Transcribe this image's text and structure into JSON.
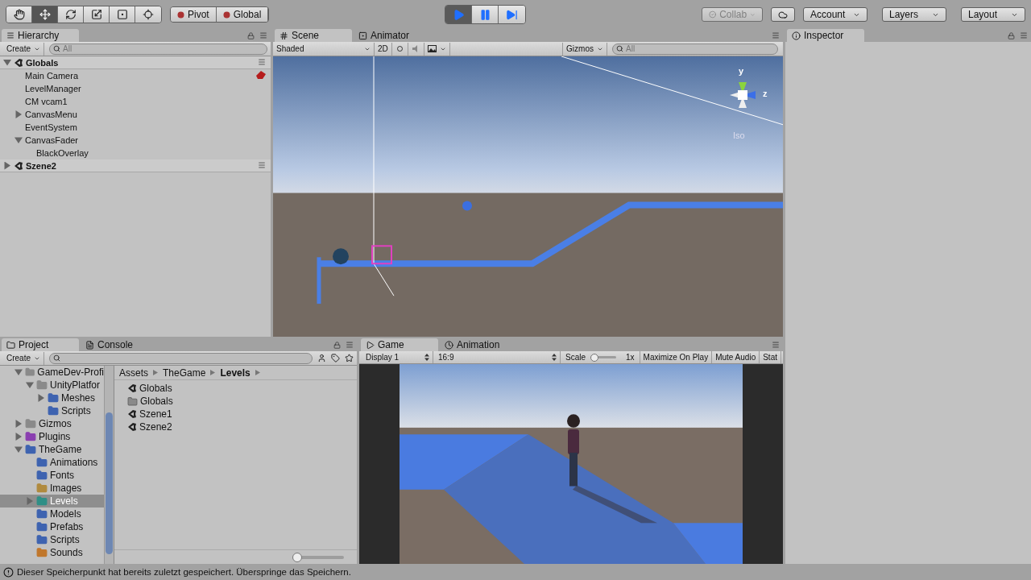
{
  "toolbar": {
    "transform_tools": [
      {
        "selected": false
      },
      {
        "selected": true
      },
      {
        "selected": false
      },
      {
        "selected": false
      },
      {
        "selected": false
      },
      {
        "selected": false
      }
    ],
    "pivot_buttons": [
      "Pivot",
      "Global"
    ],
    "play_controls": [
      {
        "kind": "play",
        "selected": true
      },
      {
        "kind": "pause",
        "selected": false
      },
      {
        "kind": "step",
        "selected": false
      }
    ],
    "collab": {
      "label": "Collab",
      "disabled": true
    },
    "menus": [
      "Account",
      "Layers",
      "Layout"
    ]
  },
  "hierarchy": {
    "tab": "Hierarchy",
    "create": "Create",
    "search_placeholder": "All",
    "scenes": [
      {
        "name": "Globals",
        "expanded": true,
        "children": [
          {
            "name": "Main Camera",
            "warning": true
          },
          {
            "name": "LevelManager"
          },
          {
            "name": "CM vcam1"
          },
          {
            "name": "CanvasMenu",
            "expanded": false
          },
          {
            "name": "EventSystem"
          },
          {
            "name": "CanvasFader",
            "expanded": true,
            "children": [
              {
                "name": "BlackOverlay"
              }
            ]
          }
        ]
      },
      {
        "name": "Szene2",
        "expanded": false
      }
    ]
  },
  "scene": {
    "tabs": [
      {
        "label": "Scene",
        "kind": "scene",
        "selected": true
      },
      {
        "label": "Animator",
        "kind": "animator",
        "selected": false
      }
    ],
    "shading": "Shaded",
    "mode_2d": "2D",
    "gizmos": "Gizmos",
    "search_placeholder": "All",
    "axis_labels": [
      "y",
      "z"
    ],
    "projection": "Iso"
  },
  "inspector": {
    "tab": "Inspector"
  },
  "project": {
    "tabs": [
      {
        "label": "Project",
        "kind": "project",
        "selected": true
      },
      {
        "label": "Console",
        "kind": "console",
        "selected": false
      }
    ],
    "create": "Create",
    "folders": [
      {
        "name": "GameDev-Profi",
        "color": "#8a8a8a",
        "selected": false,
        "expanded": true,
        "children": [
          {
            "name": "UnityPlatfor",
            "color": "#8a8a8a",
            "selected": false,
            "expanded": true,
            "children": [
              {
                "name": "Meshes",
                "color": "#3e63b0",
                "selected": false,
                "expanded": false
              },
              {
                "name": "Scripts",
                "color": "#3e63b0",
                "selected": false
              }
            ]
          }
        ]
      },
      {
        "name": "Gizmos",
        "color": "#8a8a8a",
        "selected": false,
        "expanded": false
      },
      {
        "name": "Plugins",
        "color": "#8a3fb0",
        "selected": false,
        "expanded": false
      },
      {
        "name": "TheGame",
        "color": "#3e63b0",
        "selected": false,
        "expanded": true,
        "children": [
          {
            "name": "Animations",
            "color": "#3e63b0",
            "selected": false
          },
          {
            "name": "Fonts",
            "color": "#3e63b0",
            "selected": false
          },
          {
            "name": "Images",
            "color": "#b08a3e",
            "selected": false
          },
          {
            "name": "Levels",
            "color": "#2f8f86",
            "selected": true,
            "expanded": false
          },
          {
            "name": "Models",
            "color": "#3e63b0",
            "selected": false
          },
          {
            "name": "Prefabs",
            "color": "#3e63b0",
            "selected": false
          },
          {
            "name": "Scripts",
            "color": "#3e63b0",
            "selected": false
          },
          {
            "name": "Sounds",
            "color": "#c0772c",
            "selected": false
          }
        ]
      }
    ],
    "breadcrumb": [
      "Assets",
      "TheGame",
      "Levels"
    ],
    "files": [
      {
        "name": "Globals",
        "kind": "scene"
      },
      {
        "name": "Globals",
        "kind": "folder"
      },
      {
        "name": "Szene1",
        "kind": "scene"
      },
      {
        "name": "Szene2",
        "kind": "scene"
      }
    ],
    "icon_size": {
      "level": 0
    }
  },
  "game": {
    "tabs": [
      {
        "label": "Game",
        "kind": "game",
        "selected": true
      },
      {
        "label": "Animation",
        "kind": "animation",
        "selected": false
      }
    ],
    "display": "Display 1",
    "aspect": "16:9",
    "scale_label": "Scale",
    "scale": {
      "level": 0
    },
    "scale_value": "1x",
    "buttons": [
      "Maximize On Play",
      "Mute Audio",
      "Stat"
    ]
  },
  "status_bar": {
    "message": "Dieser Speicherpunkt hat bereits zuletzt gespeichert. Überspringe das Speichern."
  }
}
